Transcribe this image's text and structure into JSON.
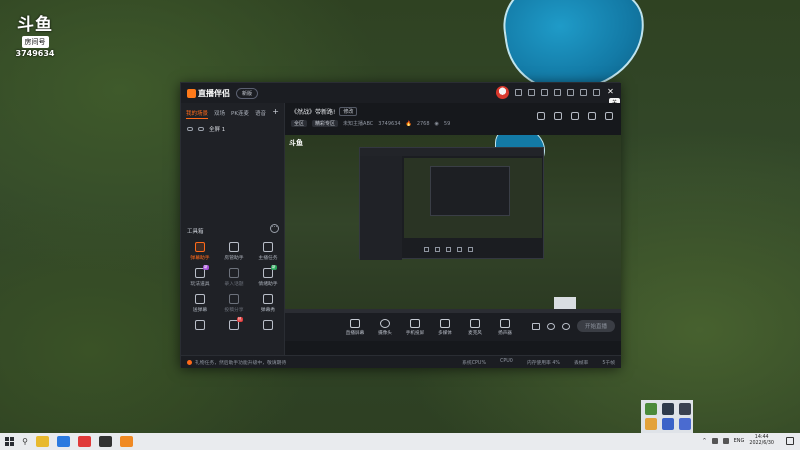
{
  "watermark": {
    "brand": "斗鱼",
    "badge": "房间号",
    "room_id": "3749634"
  },
  "app": {
    "name": "直播伴侣",
    "version_pill": "新版",
    "tooltip_close": "关闭",
    "sidebar": {
      "tabs": [
        "我的场景",
        "双场",
        "PK连麦",
        "语音"
      ],
      "active_tab": "我的场景",
      "add_label": "+",
      "scene": "全屏 1",
      "toolbox_title": "工具箱",
      "toolbox_more": "···",
      "tools": [
        {
          "label": "弹幕助手",
          "state": "hot"
        },
        {
          "label": "房管助手",
          "state": "normal"
        },
        {
          "label": "主播任务",
          "state": "normal"
        },
        {
          "label": "玩法道具",
          "state": "normal",
          "badge": "新",
          "badge_color": "#a24fd6"
        },
        {
          "label": "录入话题",
          "state": "dim"
        },
        {
          "label": "情绪助手",
          "state": "normal",
          "badge": "新",
          "badge_color": "#2aa55a"
        },
        {
          "label": "送弹幕",
          "state": "normal"
        },
        {
          "label": "投稿分享",
          "state": "dim"
        },
        {
          "label": "弹幕秀",
          "state": "normal"
        },
        {
          "label": "",
          "state": "normal"
        },
        {
          "label": "",
          "state": "normal",
          "badge": "热",
          "badge_color": "#e23b3b"
        },
        {
          "label": "",
          "state": "normal"
        }
      ]
    },
    "room": {
      "title": "《然战》带新路!",
      "modify": "修改",
      "tags": [
        "全区",
        "精彩专区"
      ],
      "host": "未知主播ABC",
      "room_number": "3749634",
      "heat": "2768",
      "fans": "59"
    },
    "preview": {
      "watermark": "斗鱼"
    },
    "controls": [
      {
        "label": "直播屏幕"
      },
      {
        "label": "摄像头"
      },
      {
        "label": "手机投屏"
      },
      {
        "label": "多媒体"
      },
      {
        "label": "麦克风"
      },
      {
        "label": "扬声器"
      }
    ],
    "live_button": "开始直播",
    "status": {
      "left": "礼物任务，然后助手功能升级中，敬请期待",
      "right": [
        "系统CPU%",
        "CPU0",
        "内存使用率 4%",
        "丢帧率",
        "5千帧"
      ]
    }
  },
  "taskbar": {
    "search_icon": "search-icon",
    "apps": [
      {
        "name": "chrome-icon",
        "color": "#e8b92e"
      },
      {
        "name": "edge-icon",
        "color": "#2b7ae0"
      },
      {
        "name": "record-icon",
        "color": "#e03a3a"
      },
      {
        "name": "unreal-icon",
        "color": "#333333"
      },
      {
        "name": "douyu-companion-icon",
        "color": "#f08a24"
      }
    ],
    "tray_lang": "ENG",
    "time": "14:44",
    "date": "2022/6/30"
  },
  "colors": {
    "accent": "#ff6a1a"
  }
}
